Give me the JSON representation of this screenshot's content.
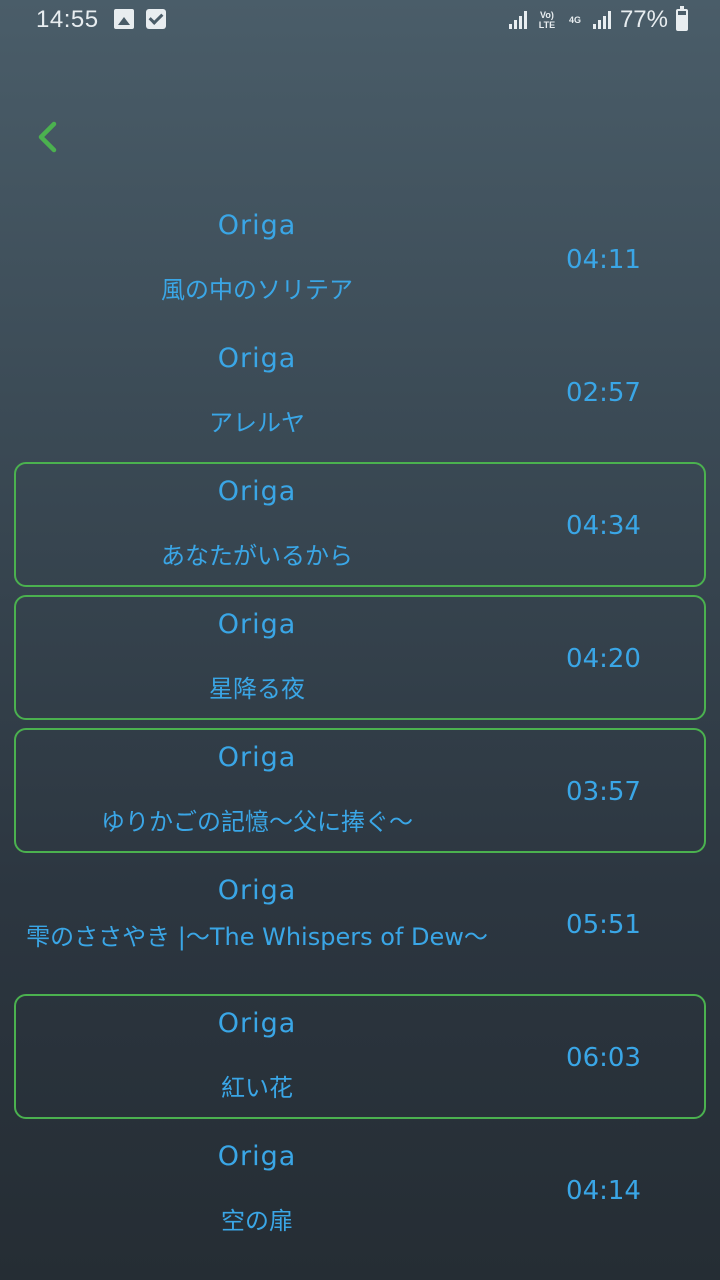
{
  "status_bar": {
    "time": "14:55",
    "battery": "77%",
    "volte_label": "Vo) LTE",
    "network_label": "4G"
  },
  "tracks": [
    {
      "artist": "Origa",
      "title": "風の中のソリテア",
      "duration": "04:11",
      "selected": false
    },
    {
      "artist": "Origa",
      "title": "アレルヤ",
      "duration": "02:57",
      "selected": false
    },
    {
      "artist": "Origa",
      "title": "あなたがいるから",
      "duration": "04:34",
      "selected": true
    },
    {
      "artist": "Origa",
      "title": "星降る夜",
      "duration": "04:20",
      "selected": true
    },
    {
      "artist": "Origa",
      "title": "ゆりかごの記憶〜父に捧ぐ〜",
      "duration": "03:57",
      "selected": true
    },
    {
      "artist": "Origa",
      "title": "雫のささやき |〜The Whispers of Dew〜",
      "duration": "05:51",
      "selected": false
    },
    {
      "artist": "Origa",
      "title": "紅い花",
      "duration": "06:03",
      "selected": true
    },
    {
      "artist": "Origa",
      "title": "空の扉",
      "duration": "04:14",
      "selected": false
    }
  ],
  "colors": {
    "accent_green": "#4bb14f",
    "text_blue": "#3aa6e6"
  }
}
